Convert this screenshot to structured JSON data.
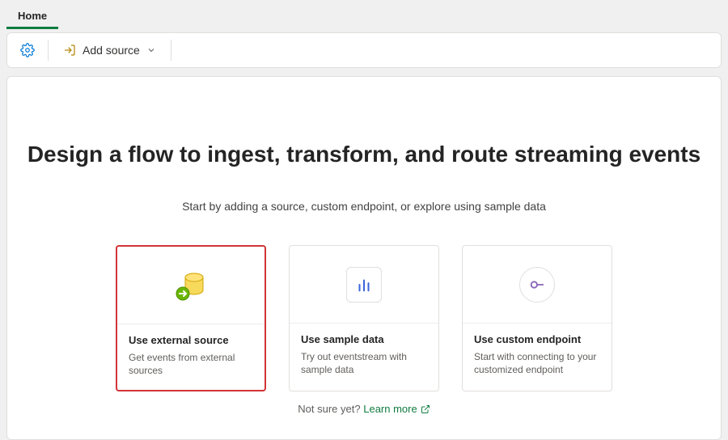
{
  "tabs": {
    "home": "Home"
  },
  "toolbar": {
    "settings_icon": "settings",
    "add_source_label": "Add source"
  },
  "hero": {
    "title": "Design a flow to ingest, transform, and route streaming events",
    "subtitle": "Start by adding a source, custom endpoint, or explore using sample data"
  },
  "cards": [
    {
      "title": "Use external source",
      "desc": "Get events from external sources"
    },
    {
      "title": "Use sample data",
      "desc": "Try out eventstream with sample data"
    },
    {
      "title": "Use custom endpoint",
      "desc": "Start with connecting to your customized endpoint"
    }
  ],
  "footer": {
    "prompt": "Not sure yet?",
    "learn": "Learn more"
  }
}
